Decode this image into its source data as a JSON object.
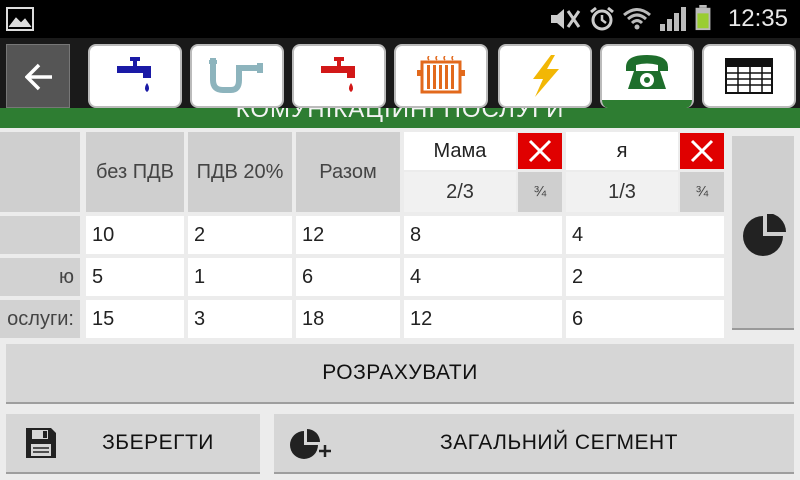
{
  "status_bar": {
    "time": "12:35",
    "icons": [
      "gallery-icon",
      "mute-icon",
      "alarm-icon",
      "wifi-icon",
      "signal-icon",
      "battery-icon"
    ]
  },
  "toolbar": {
    "back_icon": "back-arrow-icon",
    "tabs": [
      {
        "name": "cold-water",
        "icon": "faucet-blue-icon",
        "active": false
      },
      {
        "name": "sewage",
        "icon": "pipe-icon",
        "active": false
      },
      {
        "name": "hot-water",
        "icon": "faucet-red-icon",
        "active": false
      },
      {
        "name": "heating",
        "icon": "radiator-icon",
        "active": false
      },
      {
        "name": "electricity",
        "icon": "lightning-icon",
        "active": false
      },
      {
        "name": "phone",
        "icon": "telephone-icon",
        "active": true
      },
      {
        "name": "table",
        "icon": "table-icon",
        "active": false
      }
    ]
  },
  "section_title": "КОМУНІКАЦІЙНІ ПОСЛУГИ",
  "table": {
    "headers": {
      "no_vat": "без ПДВ",
      "vat": "ПДВ 20%",
      "total": "Разом"
    },
    "persons": [
      {
        "name": "Мама",
        "share": "2/3",
        "fraction_button": "¾"
      },
      {
        "name": "я",
        "share": "1/3",
        "fraction_button": "¾"
      }
    ],
    "rows": [
      {
        "label": "",
        "no_vat": "10",
        "vat": "2",
        "total": "12",
        "p1": "8",
        "p2": "4"
      },
      {
        "label": "ю",
        "no_vat": "5",
        "vat": "1",
        "total": "6",
        "p1": "4",
        "p2": "2"
      },
      {
        "label": "ослуги:",
        "no_vat": "15",
        "vat": "3",
        "total": "18",
        "p1": "12",
        "p2": "6"
      }
    ]
  },
  "buttons": {
    "calculate": "РОЗРАХУВАТИ",
    "save": "ЗБЕРЕГТИ",
    "general_segment": "ЗАГАЛЬНИЙ СЕГМЕНТ"
  },
  "colors": {
    "accent_green": "#2e7d32",
    "delete_red": "#e00000",
    "electric_yellow": "#f2b705",
    "water_blue": "#1a1aa6",
    "hot_red": "#d21818"
  }
}
